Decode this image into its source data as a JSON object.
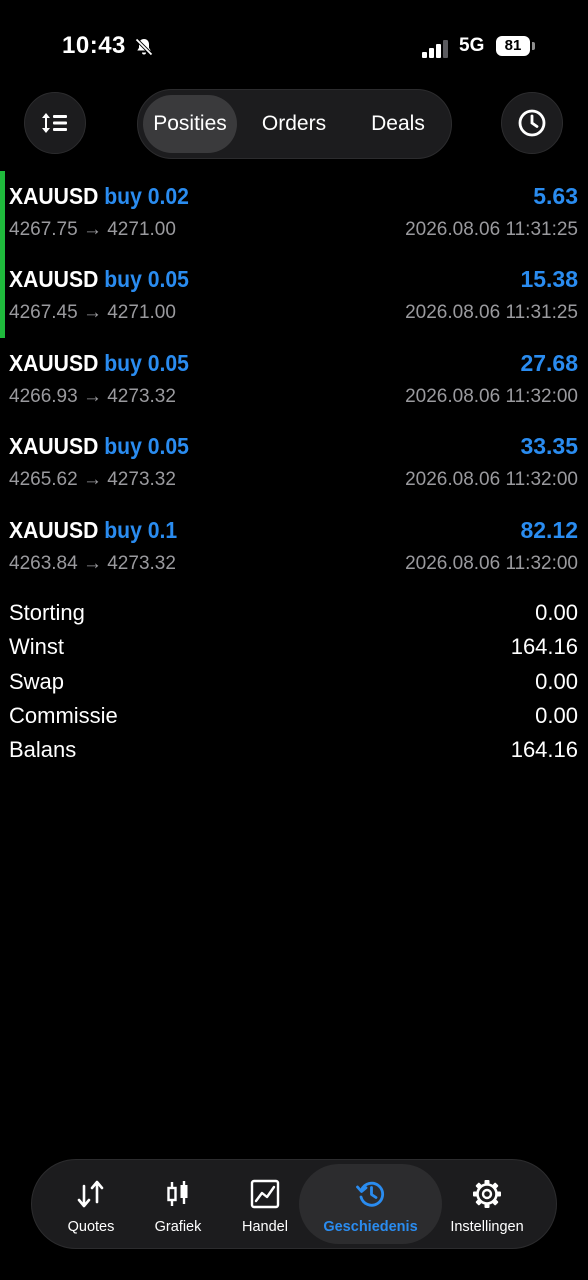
{
  "status_bar": {
    "time": "10:43",
    "network": "5G",
    "battery": "81"
  },
  "segments": [
    {
      "label": "Posities",
      "active": true
    },
    {
      "label": "Orders",
      "active": false
    },
    {
      "label": "Deals",
      "active": false
    }
  ],
  "deals": [
    {
      "symbol": "XAUUSD",
      "side": "buy 0.02",
      "profit": "5.63",
      "prices": "4267.75 → 4271.00",
      "date": "2026.08.06 11:31:25"
    },
    {
      "symbol": "XAUUSD",
      "side": "buy 0.05",
      "profit": "15.38",
      "prices": "4267.45 → 4271.00",
      "date": "2026.08.06 11:31:25"
    },
    {
      "symbol": "XAUUSD",
      "side": "buy 0.05",
      "profit": "27.68",
      "prices": "4266.93 → 4273.32",
      "date": "2026.08.06 11:32:00"
    },
    {
      "symbol": "XAUUSD",
      "side": "buy 0.05",
      "profit": "33.35",
      "prices": "4265.62 → 4273.32",
      "date": "2026.08.06 11:32:00"
    },
    {
      "symbol": "XAUUSD",
      "side": "buy 0.1",
      "profit": "82.12",
      "prices": "4263.84 → 4273.32",
      "date": "2026.08.06 11:32:00"
    }
  ],
  "summary": [
    {
      "label": "Storting",
      "value": "0.00"
    },
    {
      "label": "Winst",
      "value": "164.16"
    },
    {
      "label": "Swap",
      "value": "0.00"
    },
    {
      "label": "Commissie",
      "value": "0.00"
    },
    {
      "label": "Balans",
      "value": "164.16"
    }
  ],
  "tabs": [
    {
      "label": "Quotes",
      "icon": "quotes-arrows-icon"
    },
    {
      "label": "Grafiek",
      "icon": "candlestick-icon"
    },
    {
      "label": "Handel",
      "icon": "trade-chart-icon"
    },
    {
      "label": "Geschiedenis",
      "icon": "history-icon",
      "active": true
    },
    {
      "label": "Instellingen",
      "icon": "gear-icon"
    }
  ],
  "colors": {
    "accent": "#2a8cf0",
    "indicator": "#1fba3c",
    "background": "#000000",
    "muted": "#9a9a9e"
  }
}
